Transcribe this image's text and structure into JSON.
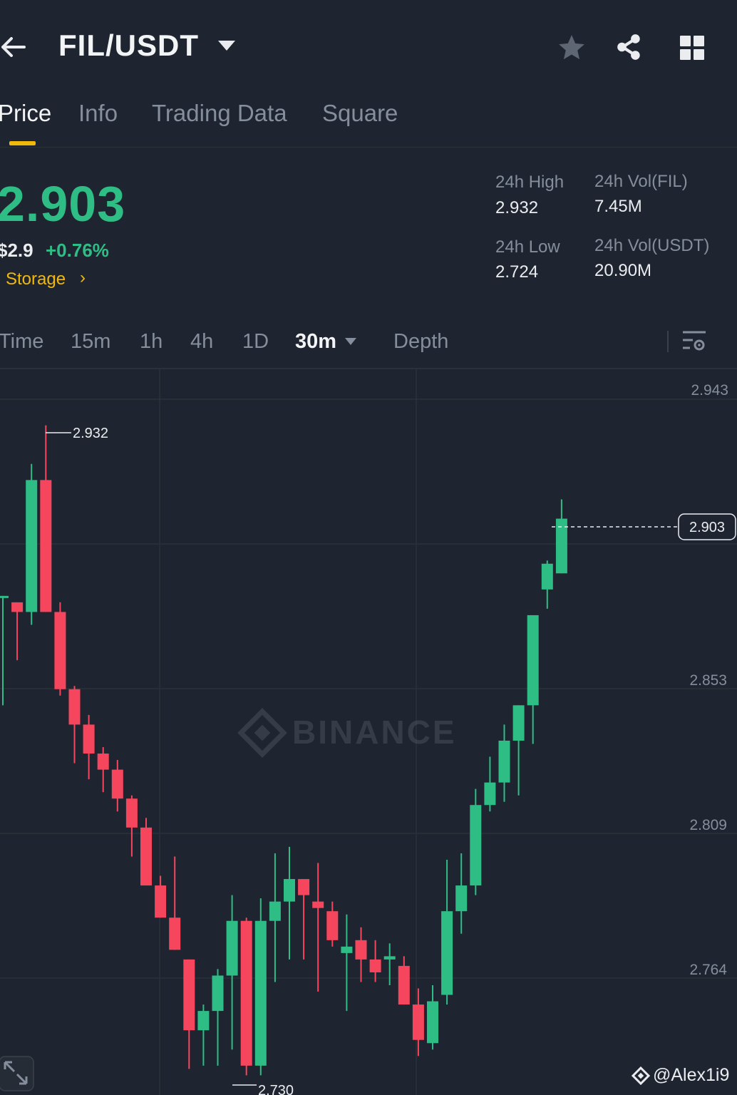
{
  "header": {
    "pair": "FIL/USDT",
    "icons": [
      "back-arrow-icon",
      "chevron-down-icon",
      "star-icon",
      "share-icon",
      "grid-icon"
    ]
  },
  "tabs": [
    {
      "label": "Price",
      "active": true
    },
    {
      "label": "Info",
      "active": false
    },
    {
      "label": "Trading Data",
      "active": false
    },
    {
      "label": "Square",
      "active": false
    }
  ],
  "ticker": {
    "last_price": "2.903",
    "usd_price": "$2.9",
    "change": "+0.76%",
    "tag": "Storage",
    "high_label": "24h High",
    "high_value": "2.932",
    "low_label": "24h Low",
    "low_value": "2.724",
    "vol_base_label": "24h Vol(FIL)",
    "vol_base_value": "7.45M",
    "vol_quote_label": "24h Vol(USDT)",
    "vol_quote_value": "20.90M"
  },
  "intervals": [
    {
      "label": "Time",
      "active": false
    },
    {
      "label": "15m",
      "active": false
    },
    {
      "label": "1h",
      "active": false
    },
    {
      "label": "4h",
      "active": false
    },
    {
      "label": "1D",
      "active": false
    },
    {
      "label": "30m",
      "active": true
    },
    {
      "label": "Depth",
      "active": false
    }
  ],
  "chart": {
    "watermark": "BINANCE",
    "user_tag": "@Alex1i9",
    "colors": {
      "up": "#2ebd85",
      "down": "#f6465d",
      "grid": "#2b3139",
      "background": "#1f2530"
    }
  },
  "chart_data": {
    "type": "candlestick",
    "y_axis_labels": [
      "2.943",
      "2.853",
      "2.809",
      "2.764"
    ],
    "ylim": [
      2.72,
      2.948
    ],
    "current_price": "2.903",
    "high_marker": "2.932",
    "low_marker": "2.730",
    "candles": [
      {
        "o": 2.879,
        "h": 2.879,
        "l": 2.845,
        "c": 2.879
      },
      {
        "o": 2.877,
        "h": 2.875,
        "l": 2.859,
        "c": 2.874
      },
      {
        "o": 2.874,
        "h": 2.92,
        "l": 2.87,
        "c": 2.915
      },
      {
        "o": 2.915,
        "h": 2.932,
        "l": 2.874,
        "c": 2.874
      },
      {
        "o": 2.874,
        "h": 2.877,
        "l": 2.848,
        "c": 2.85
      },
      {
        "o": 2.85,
        "h": 2.851,
        "l": 2.827,
        "c": 2.839
      },
      {
        "o": 2.839,
        "h": 2.842,
        "l": 2.822,
        "c": 2.83
      },
      {
        "o": 2.83,
        "h": 2.832,
        "l": 2.818,
        "c": 2.825
      },
      {
        "o": 2.825,
        "h": 2.828,
        "l": 2.812,
        "c": 2.816
      },
      {
        "o": 2.816,
        "h": 2.817,
        "l": 2.798,
        "c": 2.807
      },
      {
        "o": 2.807,
        "h": 2.81,
        "l": 2.789,
        "c": 2.789
      },
      {
        "o": 2.789,
        "h": 2.792,
        "l": 2.779,
        "c": 2.779
      },
      {
        "o": 2.779,
        "h": 2.798,
        "l": 2.769,
        "c": 2.769
      },
      {
        "o": 2.766,
        "h": 2.766,
        "l": 2.732,
        "c": 2.744
      },
      {
        "o": 2.744,
        "h": 2.752,
        "l": 2.733,
        "c": 2.75
      },
      {
        "o": 2.75,
        "h": 2.763,
        "l": 2.733,
        "c": 2.761
      },
      {
        "o": 2.761,
        "h": 2.786,
        "l": 2.738,
        "c": 2.778
      },
      {
        "o": 2.778,
        "h": 2.779,
        "l": 2.73,
        "c": 2.733
      },
      {
        "o": 2.733,
        "h": 2.785,
        "l": 2.73,
        "c": 2.778
      },
      {
        "o": 2.778,
        "h": 2.799,
        "l": 2.759,
        "c": 2.784
      },
      {
        "o": 2.784,
        "h": 2.801,
        "l": 2.766,
        "c": 2.791
      },
      {
        "o": 2.791,
        "h": 2.791,
        "l": 2.766,
        "c": 2.786
      },
      {
        "o": 2.784,
        "h": 2.796,
        "l": 2.756,
        "c": 2.782
      },
      {
        "o": 2.781,
        "h": 2.784,
        "l": 2.77,
        "c": 2.772
      },
      {
        "o": 2.768,
        "h": 2.78,
        "l": 2.75,
        "c": 2.77
      },
      {
        "o": 2.772,
        "h": 2.776,
        "l": 2.759,
        "c": 2.766
      },
      {
        "o": 2.766,
        "h": 2.772,
        "l": 2.759,
        "c": 2.762
      },
      {
        "o": 2.766,
        "h": 2.771,
        "l": 2.758,
        "c": 2.767
      },
      {
        "o": 2.764,
        "h": 2.767,
        "l": 2.753,
        "c": 2.752
      },
      {
        "o": 2.752,
        "h": 2.757,
        "l": 2.736,
        "c": 2.741
      },
      {
        "o": 2.74,
        "h": 2.758,
        "l": 2.738,
        "c": 2.753
      },
      {
        "o": 2.755,
        "h": 2.797,
        "l": 2.752,
        "c": 2.781
      },
      {
        "o": 2.781,
        "h": 2.799,
        "l": 2.774,
        "c": 2.789
      },
      {
        "o": 2.789,
        "h": 2.819,
        "l": 2.786,
        "c": 2.814
      },
      {
        "o": 2.814,
        "h": 2.829,
        "l": 2.812,
        "c": 2.821
      },
      {
        "o": 2.821,
        "h": 2.839,
        "l": 2.815,
        "c": 2.834
      },
      {
        "o": 2.834,
        "h": 2.845,
        "l": 2.817,
        "c": 2.845
      },
      {
        "o": 2.845,
        "h": 2.867,
        "l": 2.833,
        "c": 2.873
      },
      {
        "o": 2.881,
        "h": 2.89,
        "l": 2.875,
        "c": 2.889
      },
      {
        "o": 2.886,
        "h": 2.909,
        "l": 2.886,
        "c": 2.903
      }
    ]
  }
}
